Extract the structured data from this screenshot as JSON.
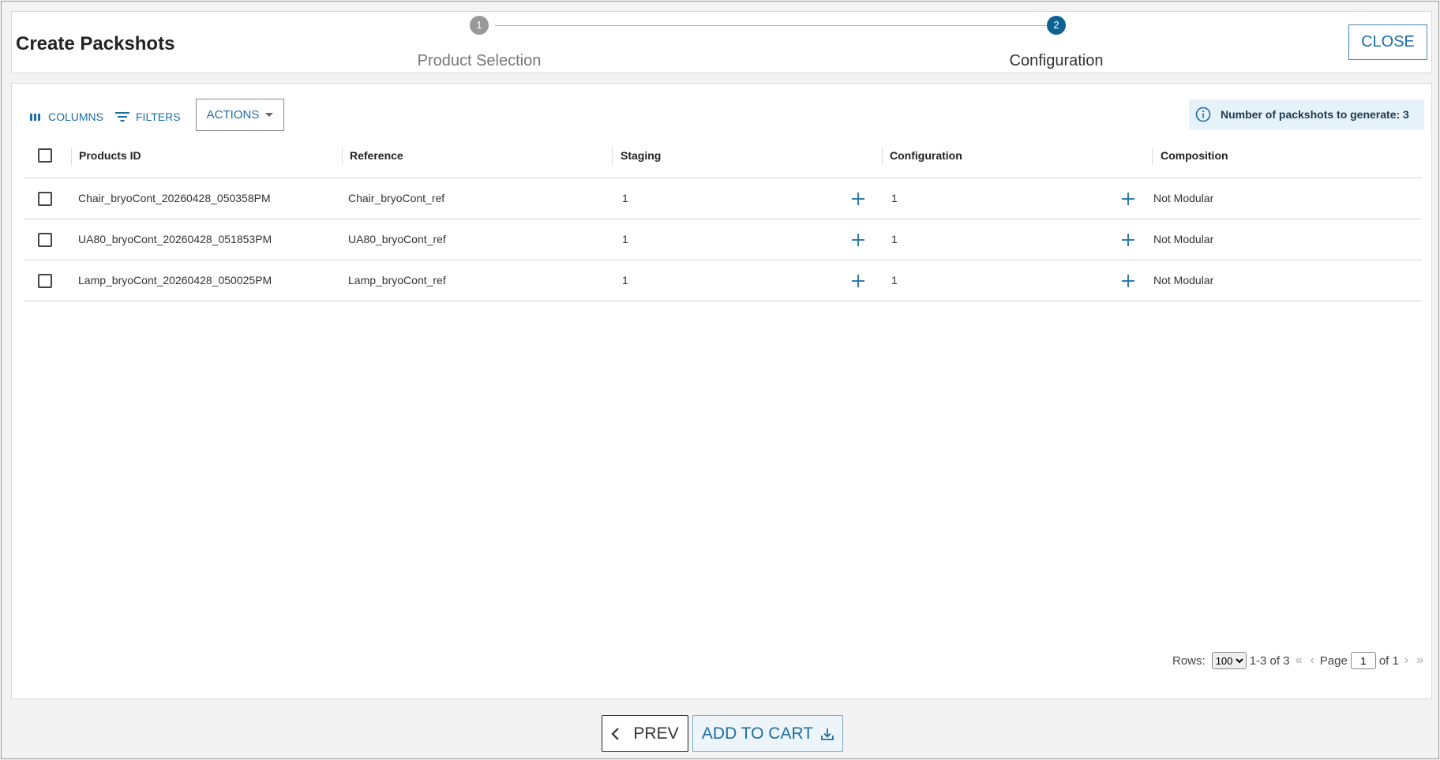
{
  "header": {
    "title": "Create Packshots",
    "close_label": "CLOSE"
  },
  "stepper": {
    "steps": [
      {
        "number": "1",
        "label": "Product Selection",
        "active": false
      },
      {
        "number": "2",
        "label": "Configuration",
        "active": true
      }
    ]
  },
  "toolbar": {
    "columns_label": "COLUMNS",
    "filters_label": "FILTERS",
    "actions_label": "ACTIONS",
    "info_text": "Number of packshots to generate: 3"
  },
  "table": {
    "headers": {
      "products_id": "Products ID",
      "reference": "Reference",
      "staging": "Staging",
      "configuration": "Configuration",
      "composition": "Composition"
    },
    "rows": [
      {
        "products_id": "Chair_bryoCont_20260428_050358PM",
        "reference": "Chair_bryoCont_ref",
        "staging": "1",
        "configuration": "1",
        "composition": "Not Modular"
      },
      {
        "products_id": "UA80_bryoCont_20260428_051853PM",
        "reference": "UA80_bryoCont_ref",
        "staging": "1",
        "configuration": "1",
        "composition": "Not Modular"
      },
      {
        "products_id": "Lamp_bryoCont_20260428_050025PM",
        "reference": "Lamp_bryoCont_ref",
        "staging": "1",
        "configuration": "1",
        "composition": "Not Modular"
      }
    ]
  },
  "pagination": {
    "rows_label": "Rows:",
    "rows_value": "100",
    "range_text": "1-3 of 3",
    "page_label": "Page",
    "page_value": "1",
    "of_text": "of 1"
  },
  "footer": {
    "prev_label": "PREV",
    "add_to_cart_label": "ADD TO CART"
  },
  "colors": {
    "accent": "#1d6ea3",
    "step_active": "#0d6294",
    "step_inactive": "#999999",
    "info_bg": "#e6f2f9"
  }
}
